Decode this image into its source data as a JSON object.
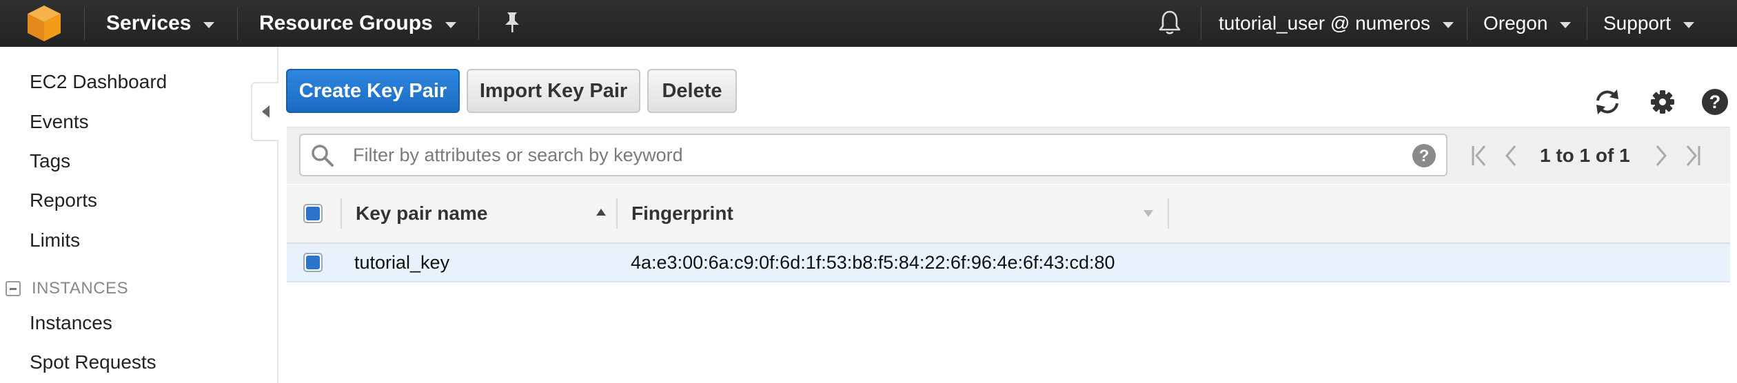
{
  "topbar": {
    "services_label": "Services",
    "resource_groups_label": "Resource Groups",
    "account_label": "tutorial_user @ numeros",
    "region_label": "Oregon",
    "support_label": "Support",
    "icons": [
      "aws-logo-icon",
      "pin-icon",
      "bell-icon"
    ]
  },
  "sidebar": {
    "items": [
      {
        "label": "EC2 Dashboard"
      },
      {
        "label": "Events"
      },
      {
        "label": "Tags"
      },
      {
        "label": "Reports"
      },
      {
        "label": "Limits"
      }
    ],
    "sections": [
      {
        "title": "INSTANCES",
        "items": [
          {
            "label": "Instances"
          },
          {
            "label": "Spot Requests"
          }
        ]
      }
    ]
  },
  "toolbar": {
    "create_label": "Create Key Pair",
    "import_label": "Import Key Pair",
    "delete_label": "Delete",
    "icons": [
      "refresh-icon",
      "gear-icon",
      "help-icon"
    ]
  },
  "filter": {
    "placeholder": "Filter by attributes or search by keyword",
    "pagination": "1 to 1 of 1"
  },
  "table": {
    "columns": [
      "Key pair name",
      "Fingerprint"
    ],
    "sorted_column": "Key pair name",
    "sort_direction": "ascending",
    "rows": [
      {
        "name": "tutorial_key",
        "fingerprint": "4a:e3:00:6a:c9:0f:6d:1f:53:b8:f5:84:22:6f:96:4e:6f:43:cd:80",
        "selected": true
      }
    ]
  },
  "colors": {
    "topbar_bg": "#232323",
    "primary_button": "#1a6cc2",
    "selected_row": "#e8f2fc",
    "logo_orange": "#f49b1a"
  }
}
